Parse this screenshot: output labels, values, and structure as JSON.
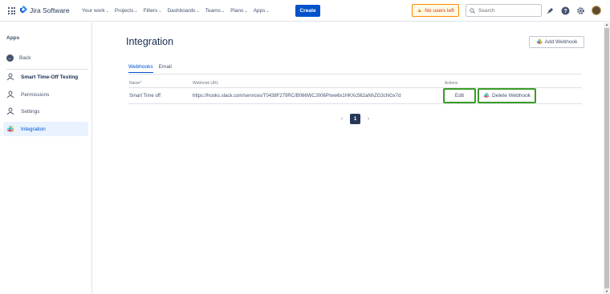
{
  "topnav": {
    "app_name": "Jira Software",
    "items": [
      {
        "label": "Your work"
      },
      {
        "label": "Projects"
      },
      {
        "label": "Filters"
      },
      {
        "label": "Dashboards"
      },
      {
        "label": "Teams"
      },
      {
        "label": "Plans"
      },
      {
        "label": "Apps"
      }
    ],
    "create_label": "Create",
    "warning_label": "No users left",
    "search_placeholder": "Search",
    "icons": [
      "notifications-icon",
      "help-icon",
      "settings-icon"
    ]
  },
  "sidebar": {
    "title": "Apps",
    "back_label": "Back",
    "items": [
      {
        "label": "Smart Time-Off Testing",
        "icon": "app-logo-icon"
      },
      {
        "label": "Permissions",
        "icon": "permissions-icon"
      },
      {
        "label": "Settings",
        "icon": "settings-icon"
      },
      {
        "label": "Integration",
        "icon": "slack-icon"
      }
    ]
  },
  "main": {
    "title": "Integration",
    "add_webhook_label": "Add Webhook",
    "tabs": [
      {
        "label": "Webhooks"
      },
      {
        "label": "Email"
      }
    ],
    "columns": {
      "name": "Name",
      "required_mark": "*",
      "url": "Webhook URL",
      "actions": "Actions"
    },
    "rows": [
      {
        "name": "Smart Time off",
        "url": "https://hooks.slack.com/services/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"
      }
    ],
    "edit_label": "Edit",
    "delete_label": "Delete Webhook",
    "pagination": {
      "prev": "‹",
      "current_page": "1",
      "next": "›"
    }
  },
  "colors": {
    "primary": "#0052cc",
    "highlight_border": "#3a9b2a",
    "warning": "#ff8b00"
  }
}
